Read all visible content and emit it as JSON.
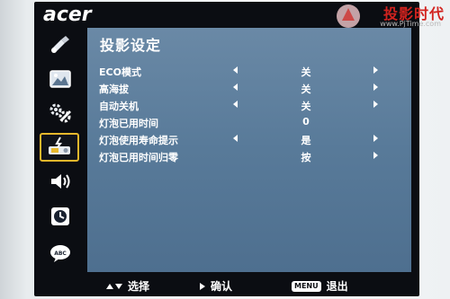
{
  "brand": {
    "logo_text": "acer"
  },
  "watermark": {
    "name": "投影时代",
    "url": "www.PjTime.com"
  },
  "rail": {
    "items": [
      {
        "icon": "color-management-icon"
      },
      {
        "icon": "image-icon"
      },
      {
        "icon": "settings-icon"
      },
      {
        "icon": "projection-management-icon",
        "selected": true
      },
      {
        "icon": "audio-icon"
      },
      {
        "icon": "timer-icon"
      },
      {
        "icon": "language-icon"
      }
    ]
  },
  "panel": {
    "title": "投影设定",
    "rows": [
      {
        "label": "ECO模式",
        "value": "关",
        "left_arrow": true,
        "right_arrow": true
      },
      {
        "label": "高海拔",
        "value": "关",
        "left_arrow": true,
        "right_arrow": true
      },
      {
        "label": "自动关机",
        "value": "关",
        "left_arrow": true,
        "right_arrow": true
      },
      {
        "label": "灯泡已用时间",
        "value": "0",
        "left_arrow": false,
        "right_arrow": false
      },
      {
        "label": "灯泡使用寿命提示",
        "value": "是",
        "left_arrow": true,
        "right_arrow": true
      },
      {
        "label": "灯泡已用时间归零",
        "value": "按",
        "left_arrow": false,
        "right_arrow": true
      }
    ]
  },
  "hints": {
    "select": "选择",
    "confirm": "确认",
    "menu_key": "MENU",
    "exit": "退出"
  },
  "colors": {
    "panel": "#587a99",
    "frame": "#0b0d12",
    "selection": "#e8b82c"
  }
}
